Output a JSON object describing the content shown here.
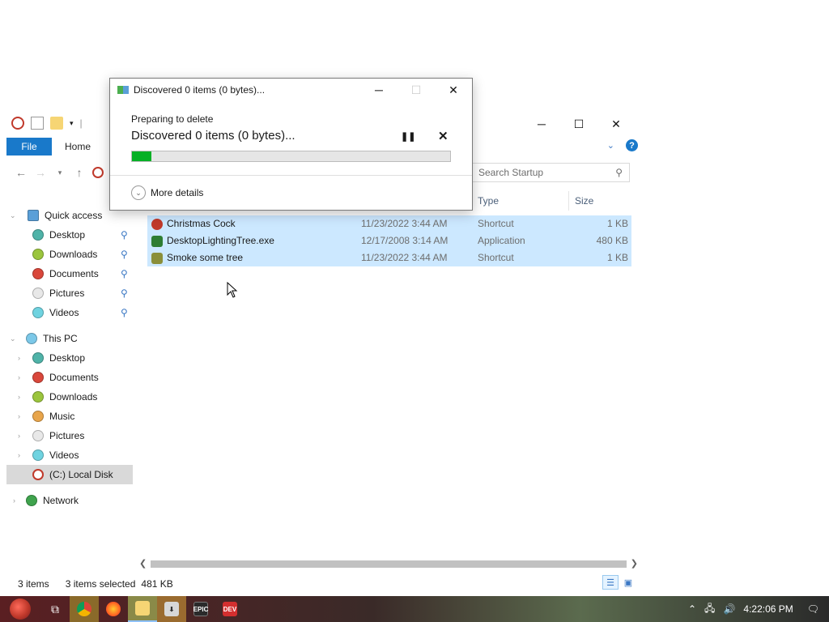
{
  "dialog": {
    "title": "Discovered 0 items (0 bytes)...",
    "subtitle": "Preparing to delete",
    "status": "Discovered 0 items (0 bytes)...",
    "progress_fraction": 0.06,
    "more_details": "More details",
    "buttons": {
      "minimize": "─",
      "maximize": "☐",
      "close": "✕",
      "pause": "❚❚",
      "cancel": "✕"
    }
  },
  "explorer": {
    "ribbon": {
      "file_tab": "File",
      "home_tab": "Home"
    },
    "window_buttons": {
      "minimize": "─",
      "maximize": "☐",
      "close": "✕"
    },
    "search_placeholder": "Search Startup",
    "columns": {
      "type": "Type",
      "size": "Size"
    },
    "nav": {
      "quick_access": "Quick access",
      "quick_items": [
        "Desktop",
        "Downloads",
        "Documents",
        "Pictures",
        "Videos"
      ],
      "this_pc": "This PC",
      "pc_items": [
        "Desktop",
        "Documents",
        "Downloads",
        "Music",
        "Pictures",
        "Videos",
        "(C:) Local Disk"
      ],
      "network": "Network"
    },
    "files": [
      {
        "name": "Christmas Cock",
        "date": "11/23/2022 3:44 AM",
        "type": "Shortcut",
        "size": "1 KB"
      },
      {
        "name": "DesktopLightingTree.exe",
        "date": "12/17/2008 3:14 AM",
        "type": "Application",
        "size": "480 KB"
      },
      {
        "name": "Smoke some tree",
        "date": "11/23/2022 3:44 AM",
        "type": "Shortcut",
        "size": "1 KB"
      }
    ],
    "status": {
      "count": "3 items",
      "selected": "3 items selected",
      "size": "481 KB"
    }
  },
  "taskbar": {
    "apps": [
      "start-icon",
      "task-view-icon",
      "chrome-icon",
      "firefox-icon",
      "file-explorer-icon",
      "installer-icon",
      "epic-games-icon",
      "devcpp-icon"
    ],
    "epic_label": "EPIC",
    "dev_label": "DEV",
    "clock": "4:22:06 PM"
  },
  "colors": {
    "accent": "#1979ca",
    "selection": "#cce8ff",
    "progress": "#06b025"
  }
}
